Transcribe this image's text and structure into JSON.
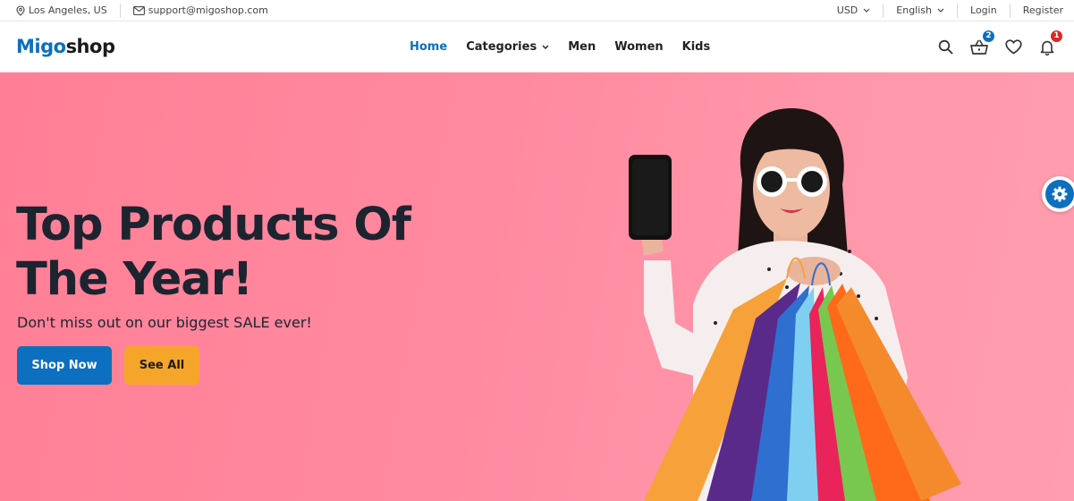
{
  "topbar": {
    "location": "Los Angeles, US",
    "email": "support@migoshop.com",
    "currency": "USD",
    "language": "English",
    "login": "Login",
    "register": "Register"
  },
  "header": {
    "logo_part1": "Migo",
    "logo_part2": "shop",
    "nav": {
      "home": "Home",
      "categories": "Categories",
      "men": "Men",
      "women": "Women",
      "kids": "Kids"
    },
    "cart_count": "2",
    "notification_count": "1"
  },
  "hero": {
    "title_line1": "Top Products Of",
    "title_line2": "The Year!",
    "subtitle": "Don't miss out on our biggest SALE ever!",
    "shop_now": "Shop Now",
    "see_all": "See All"
  },
  "colors": {
    "brand": "#0d6fbf",
    "accent": "#f5a62a",
    "hero_bg": "#ff8aa0",
    "badge_red": "#e02424"
  },
  "icons": [
    "map-pin-icon",
    "mail-icon",
    "chevron-down-icon",
    "search-icon",
    "basket-icon",
    "heart-icon",
    "bell-icon",
    "gear-icon"
  ]
}
